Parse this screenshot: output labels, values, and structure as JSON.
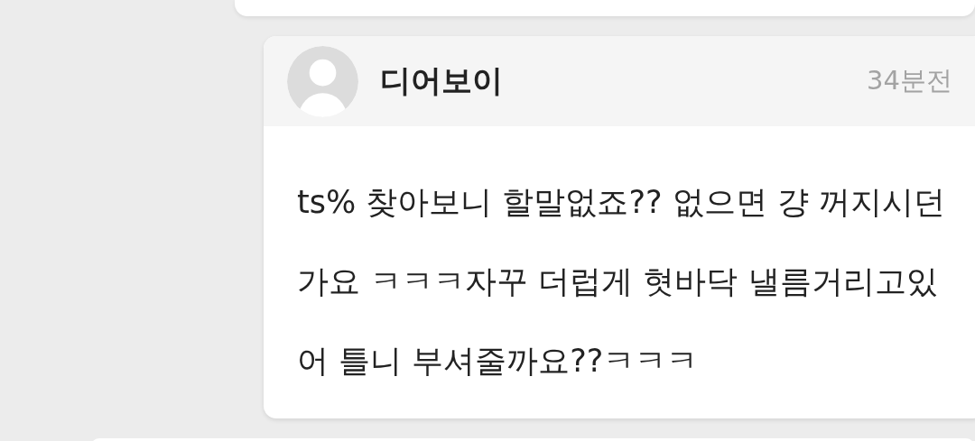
{
  "comment": {
    "author": "디어보이",
    "time": "34분전",
    "body": "ts% 찾아보니 할말없죠?? 없으면 걍 꺼지시던가요 ㅋㅋㅋ자꾸 더럽게 혓바닥 낼름거리고있어 틀니 부셔줄까요??ㅋㅋㅋ"
  }
}
